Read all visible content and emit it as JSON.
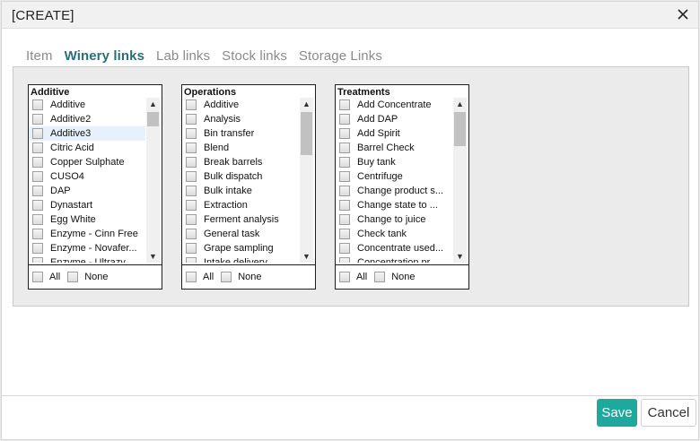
{
  "dialog": {
    "title": "[CREATE]",
    "close_icon": "close-icon"
  },
  "tabs": [
    {
      "label": "Item",
      "active": false
    },
    {
      "label": "Winery links",
      "active": true
    },
    {
      "label": "Lab links",
      "active": false
    },
    {
      "label": "Stock links",
      "active": false
    },
    {
      "label": "Storage Links",
      "active": false
    }
  ],
  "lists": [
    {
      "title": "Additive",
      "items": [
        "Additive",
        "Additive2",
        "Additive3",
        "Citric Acid",
        "Copper Sulphate",
        "CUSO4",
        "DAP",
        "Dynastart",
        "Egg White",
        "Enzyme - Cinn Free",
        "Enzyme - Novafer...",
        "Enzyme - Ultrazy..."
      ],
      "highlighted_index": 2,
      "footer_all": "All",
      "footer_none": "None"
    },
    {
      "title": "Operations",
      "items": [
        "Additive",
        "Analysis",
        "Bin transfer",
        "Blend",
        "Break barrels",
        "Bulk dispatch",
        "Bulk intake",
        "Extraction",
        "Ferment analysis",
        "General task",
        "Grape sampling",
        "Intake delivery"
      ],
      "highlighted_index": -1,
      "footer_all": "All",
      "footer_none": "None"
    },
    {
      "title": "Treatments",
      "items": [
        "Add Concentrate",
        "Add DAP",
        "Add Spirit",
        "Barrel Check",
        "Buy tank",
        "Centrifuge",
        "Change product s...",
        "Change state to ...",
        "Change to juice",
        "Check tank",
        "Concentrate used...",
        "Concentration pr..."
      ],
      "highlighted_index": -1,
      "footer_all": "All",
      "footer_none": "None"
    }
  ],
  "scroll_up_icon": "chevron-up-icon",
  "scroll_down_icon": "chevron-down-icon",
  "buttons": {
    "save": "Save",
    "cancel": "Cancel"
  },
  "colors": {
    "accent": "#1fa99e",
    "tab_active_text": "#2a6f77",
    "tab_underline": "#3fb8b0",
    "item_highlight": "#e6f1fb"
  }
}
